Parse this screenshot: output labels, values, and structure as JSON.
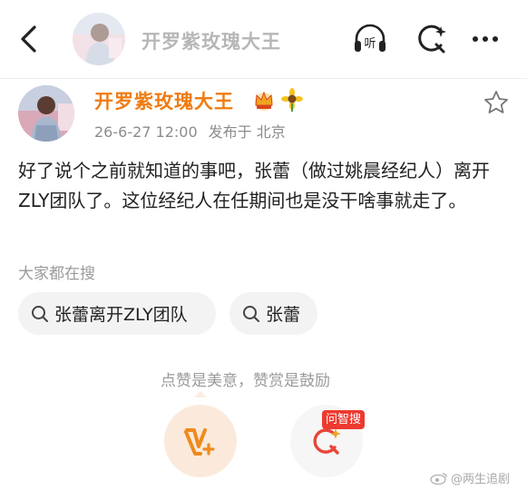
{
  "header": {
    "title": "开罗紫玫瑰大王",
    "listen_label": "听"
  },
  "post": {
    "author": "开罗紫玫瑰大王",
    "timestamp": "26-6-27 12:00",
    "location": "发布于 北京",
    "text": "好了说个之前就知道的事吧，张蕾（做过姚晨经纪人）离开ZLY团队了。这位经纪人在任期间也是没干啥事就走了。"
  },
  "hot_search": {
    "label": "大家都在搜",
    "items": [
      {
        "label": "张蕾离开ZLY团队"
      },
      {
        "label": "张蕾"
      }
    ]
  },
  "reward": {
    "caption": "点赞是美意，赞赏是鼓励",
    "ask_badge": "问智搜"
  },
  "watermark": "@两生追剧",
  "colors": {
    "accent": "#f07b11",
    "badge_red": "#ee3a2f",
    "muted": "#9a9a9a"
  }
}
